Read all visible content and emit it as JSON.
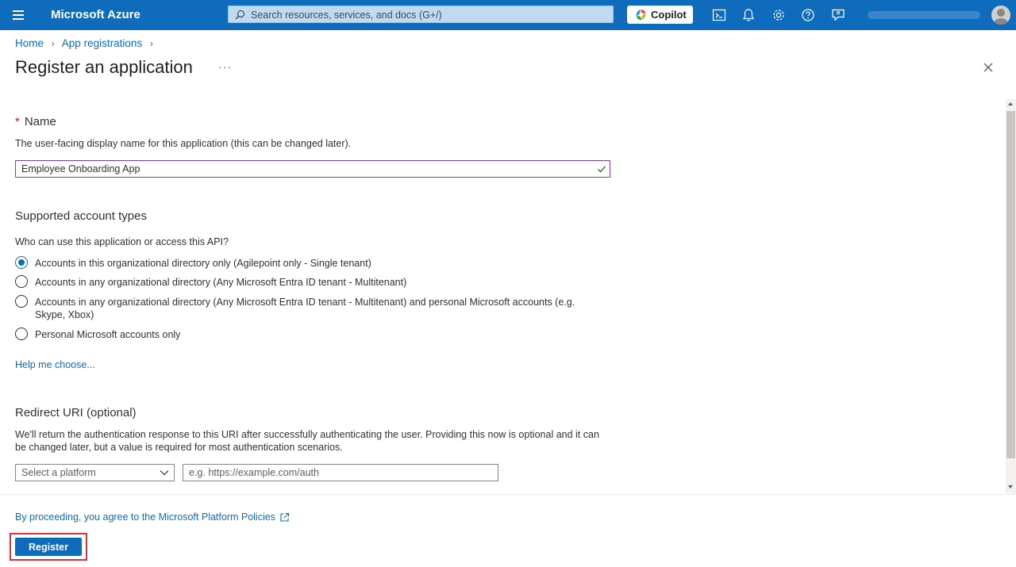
{
  "topbar": {
    "brand": "Microsoft Azure",
    "search_placeholder": "Search resources, services, and docs (G+/)",
    "copilot_label": "Copilot",
    "icons": [
      "menu-icon",
      "search-icon",
      "cloud-shell-icon",
      "notifications-icon",
      "settings-icon",
      "help-icon",
      "feedback-icon",
      "avatar"
    ]
  },
  "breadcrumb": {
    "items": [
      "Home",
      "App registrations"
    ]
  },
  "page": {
    "title": "Register an application",
    "more": "···"
  },
  "name_section": {
    "required_mark": "*",
    "label": "Name",
    "help": "The user-facing display name for this application (this can be changed later).",
    "value": "Employee Onboarding App"
  },
  "account_types": {
    "label": "Supported account types",
    "question": "Who can use this application or access this API?",
    "options": [
      {
        "label": "Accounts in this organizational directory only (Agilepoint only - Single tenant)",
        "checked": true
      },
      {
        "label": "Accounts in any organizational directory (Any Microsoft Entra ID tenant - Multitenant)",
        "checked": false
      },
      {
        "label": "Accounts in any organizational directory (Any Microsoft Entra ID tenant - Multitenant) and personal Microsoft accounts (e.g. Skype, Xbox)",
        "checked": false
      },
      {
        "label": "Personal Microsoft accounts only",
        "checked": false
      }
    ],
    "help_link": "Help me choose..."
  },
  "redirect": {
    "label": "Redirect URI (optional)",
    "help": "We'll return the authentication response to this URI after successfully authenticating the user. Providing this now is optional and it can be changed later, but a value is required for most authentication scenarios.",
    "platform_placeholder": "Select a platform",
    "uri_placeholder": "e.g. https://example.com/auth"
  },
  "footer": {
    "policy_text": "By proceeding, you agree to the Microsoft Platform Policies",
    "register_label": "Register"
  },
  "colors": {
    "topbar": "#0f6cbd",
    "link": "#0f6cbd",
    "input_focus_border": "#8a3aa3",
    "valid_check": "#107c10",
    "required": "#a4262c",
    "highlight": "#e0303a"
  }
}
